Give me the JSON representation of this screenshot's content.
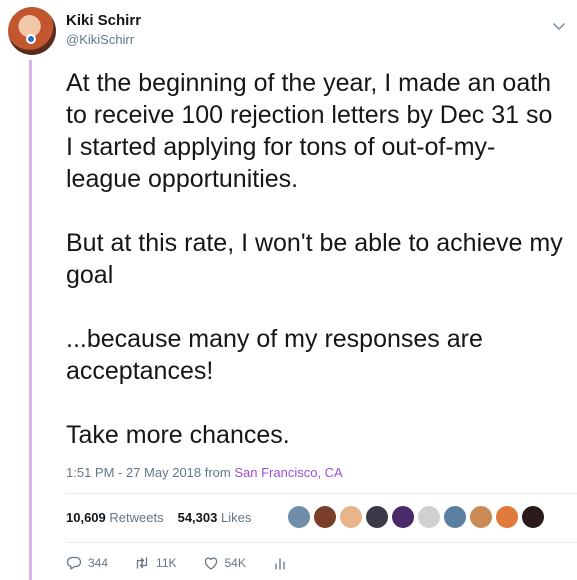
{
  "author": {
    "name": "Kiki Schirr",
    "handle": "@KikiSchirr"
  },
  "tweet": {
    "paragraphs": [
      "At the beginning of the year, I made an oath to receive 100 rejection letters by Dec 31 so I started applying for tons of out-of-my-league opportunities.",
      "But at this rate, I won't be able to achieve my goal",
      "...because many of my responses are acceptances!",
      "Take more chances."
    ]
  },
  "meta": {
    "time_date": "1:51 PM - 27 May 2018 from ",
    "location": "San Francisco, CA"
  },
  "stats": {
    "retweets_count": "10,609",
    "retweets_label": "Retweets",
    "likes_count": "54,303",
    "likes_label": "Likes"
  },
  "facepile": {
    "colors": [
      "#6f8fa8",
      "#7a3f2a",
      "#e8b58a",
      "#3a3a4a",
      "#4b2a6a",
      "#d0d0d0",
      "#5a7fa0",
      "#c98a55",
      "#e07a3a",
      "#2a1a1a"
    ]
  },
  "actions": {
    "replies": "344",
    "retweets": "11K",
    "likes": "54K"
  },
  "colors": {
    "thread_line": "#d8b4ea",
    "link": "#9b4fd6",
    "muted": "#657786"
  }
}
